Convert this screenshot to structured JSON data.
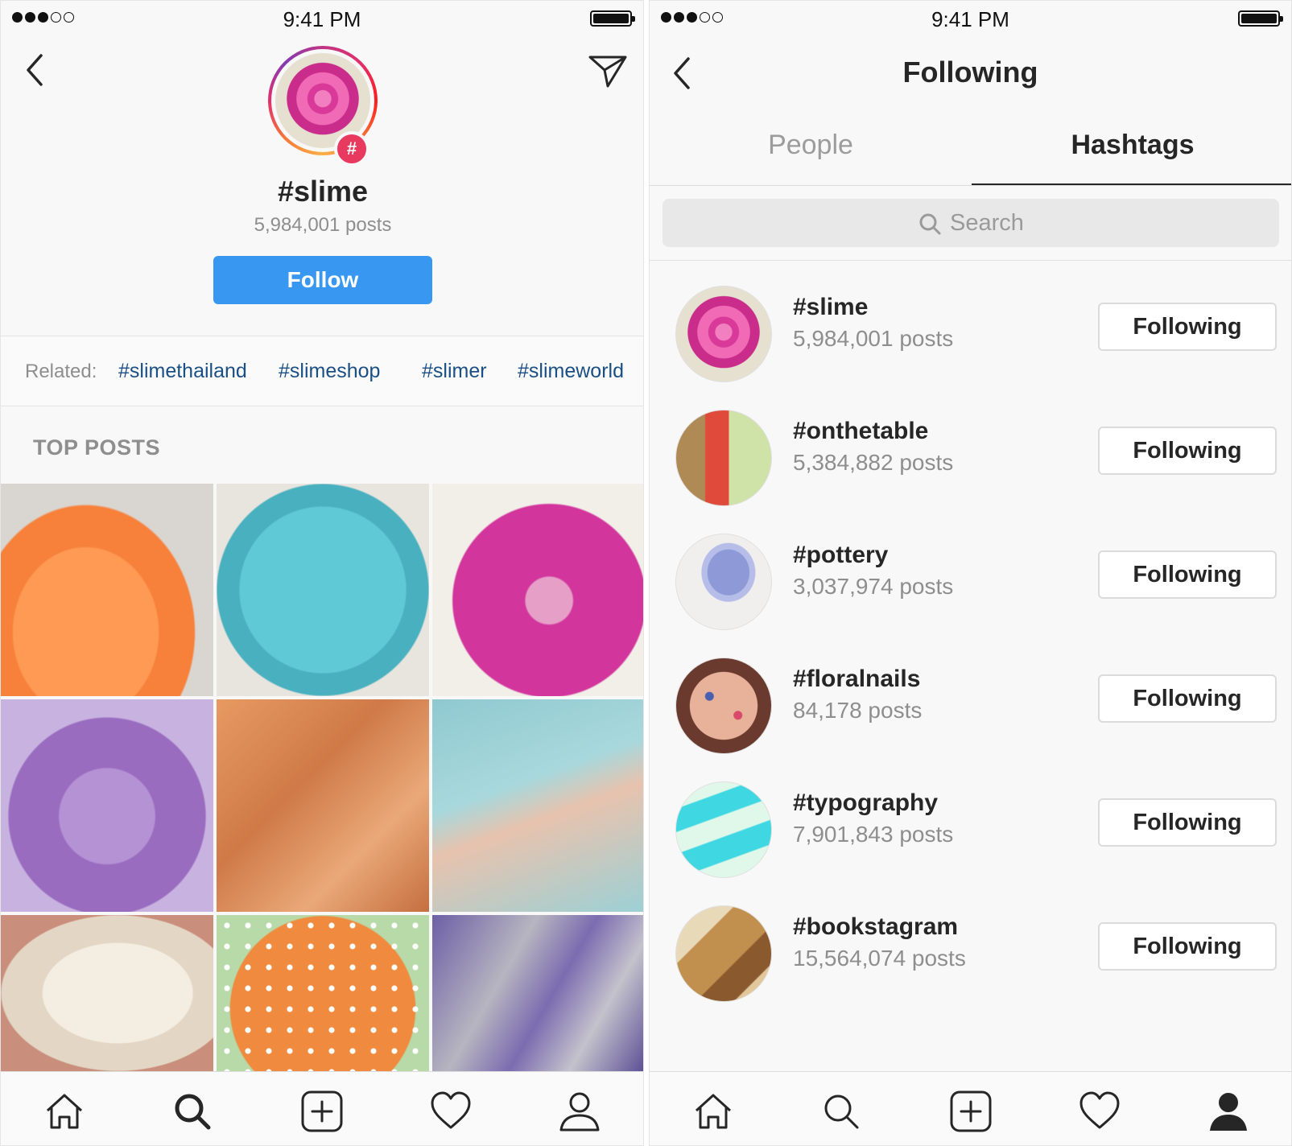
{
  "status_bar": {
    "time": "9:41 PM"
  },
  "left": {
    "tag_title": "#slime",
    "tag_posts": "5,984,001 posts",
    "hash_badge": "#",
    "follow_label": "Follow",
    "related_label": "Related:",
    "related": [
      "#slimethailand",
      "#slimeshop",
      "#slimer",
      "#slimeworld"
    ],
    "section_title": "TOP POSTS",
    "icons": [
      "back-icon",
      "send-icon",
      "home-icon",
      "search-icon",
      "add-icon",
      "heart-icon",
      "profile-icon"
    ]
  },
  "right": {
    "title": "Following",
    "tabs": {
      "people": "People",
      "hashtags": "Hashtags",
      "active": "Hashtags"
    },
    "search_placeholder": "Search",
    "items": [
      {
        "tag": "#slime",
        "posts": "5,984,001 posts",
        "button": "Following"
      },
      {
        "tag": "#onthetable",
        "posts": "5,384,882 posts",
        "button": "Following"
      },
      {
        "tag": "#pottery",
        "posts": "3,037,974 posts",
        "button": "Following"
      },
      {
        "tag": "#floralnails",
        "posts": "84,178 posts",
        "button": "Following"
      },
      {
        "tag": "#typography",
        "posts": "7,901,843 posts",
        "button": "Following"
      },
      {
        "tag": "#bookstagram",
        "posts": "15,564,074 posts",
        "button": "Following"
      }
    ]
  },
  "colors": {
    "follow_blue": "#3897f0",
    "link_blue": "#1a4f85",
    "badge_pink": "#e8395f"
  }
}
